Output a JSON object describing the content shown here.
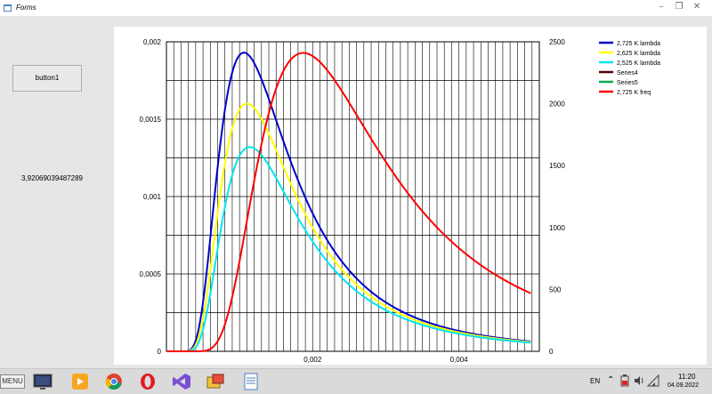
{
  "window": {
    "title": "Forms",
    "controls": [
      "–",
      "❐",
      "✕"
    ]
  },
  "left_panel": {
    "button_label": "button1",
    "value_text": "3,92069039487289"
  },
  "taskbar": {
    "menu_label": "MENU",
    "lang": "EN",
    "time": "11:20",
    "date": "04.09.2022",
    "icons": [
      "monitor-icon",
      "media-player-icon",
      "chrome-icon",
      "opera-icon",
      "visual-studio-icon",
      "app-window-icon",
      "notepad-icon"
    ]
  },
  "chart_data": {
    "type": "line",
    "x_ticks": [
      "0,002",
      "0,004"
    ],
    "x_tick_values": [
      0.002,
      0.004
    ],
    "xlim": [
      0,
      0.0051
    ],
    "y_left": {
      "ylim": [
        0,
        0.002
      ],
      "ticks": [
        "0",
        "0,0005",
        "0,001",
        "0,0015",
        "0,002"
      ],
      "tick_values": [
        0,
        0.0005,
        0.001,
        0.0015,
        0.002
      ]
    },
    "y_right": {
      "ylim": [
        0,
        2500
      ],
      "ticks": [
        "0",
        "500",
        "1000",
        "1500",
        "2000",
        "2500"
      ],
      "tick_values": [
        0,
        500,
        1000,
        1500,
        2000,
        2500
      ]
    },
    "legend": {
      "placement": "top-right",
      "entries": [
        {
          "name": "2,725 K   lambda",
          "color": "#0000cc"
        },
        {
          "name": "2,625 K   lambda",
          "color": "#ffff00"
        },
        {
          "name": "2,525 K   lambda",
          "color": "#00e5ee"
        },
        {
          "name": "Series4",
          "color": "#550000"
        },
        {
          "name": "Series5",
          "color": "#00aa55"
        },
        {
          "name": "2,725 K   freq",
          "color": "#ff0000"
        }
      ]
    },
    "series": [
      {
        "name": "2,725 K   lambda",
        "axis": "left",
        "color": "#0000cc",
        "peak_x": 0.00106,
        "peak_y": 0.00193
      },
      {
        "name": "2,625 K   lambda",
        "axis": "left",
        "color": "#ffff00",
        "peak_x": 0.0011,
        "peak_y": 0.0016
      },
      {
        "name": "2,525 K   lambda",
        "axis": "left",
        "color": "#00e5ee",
        "peak_x": 0.00114,
        "peak_y": 0.00132
      },
      {
        "name": "2,725 K   freq",
        "axis": "right",
        "color": "#ff0000",
        "peak_x": 0.00187,
        "peak_y": 2410
      }
    ],
    "grid": true
  }
}
